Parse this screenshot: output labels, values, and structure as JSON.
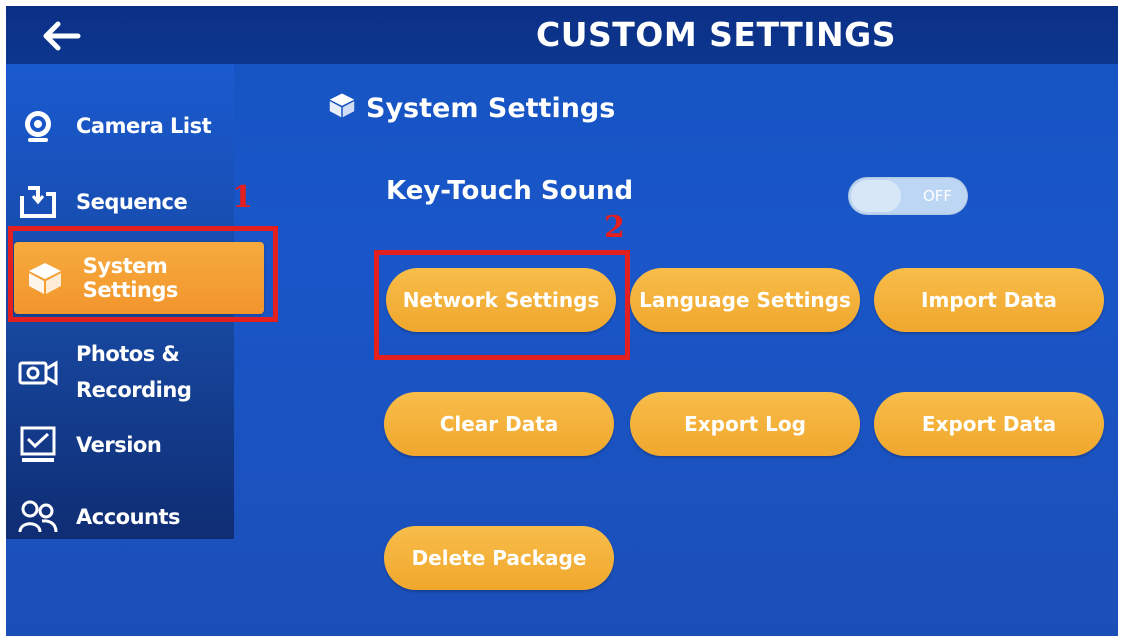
{
  "header": {
    "title": "CUSTOM SETTINGS",
    "back_icon": "arrow-left-icon"
  },
  "sidebar": {
    "items": [
      {
        "label": "Camera List",
        "icon": "webcam-icon"
      },
      {
        "label": "Sequence",
        "icon": "cycle-icon"
      },
      {
        "label": "System Settings",
        "icon": "cube-icon",
        "active": true
      },
      {
        "label_line1": "Photos &",
        "label_line2": "Recording",
        "icon": "video-camera-icon"
      },
      {
        "label": "Version",
        "icon": "version-monitor-icon"
      },
      {
        "label": "Accounts",
        "icon": "users-icon"
      }
    ]
  },
  "main": {
    "section_title": "System Settings",
    "key_touch_sound": {
      "label": "Key-Touch Sound",
      "toggle_state": "OFF"
    },
    "buttons": [
      "Network Settings",
      "Language Settings",
      "Import Data",
      "Clear Data",
      "Export Log",
      "Export Data",
      "Delete Package"
    ]
  },
  "annotations": {
    "step1": "1",
    "step2": "2"
  },
  "colors": {
    "background": "#1a56c8",
    "topbar": "#0d378f",
    "accent_orange": "#f2a33a",
    "highlight_red": "#e41f1f"
  }
}
